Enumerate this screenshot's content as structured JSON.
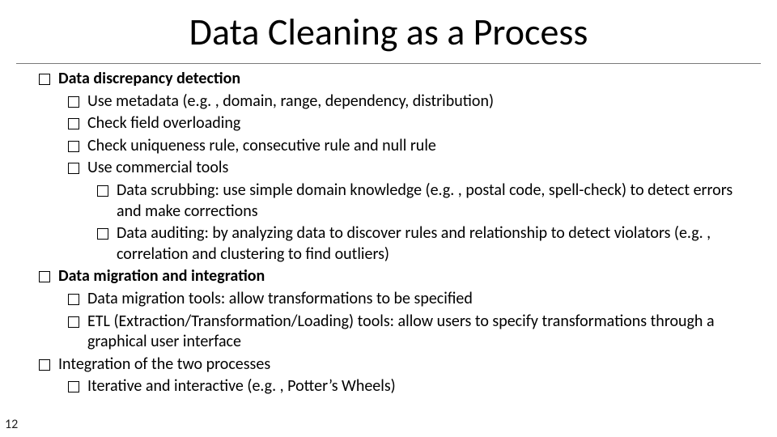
{
  "slide": {
    "title": "Data Cleaning as a Process",
    "page_number": "12",
    "items": {
      "i0": "Data discrepancy detection",
      "i1": "Use metadata (e.g. , domain, range, dependency, distribution)",
      "i2": "Check field overloading",
      "i3": "Check uniqueness rule, consecutive rule and null rule",
      "i4": "Use commercial tools",
      "i5": "Data scrubbing: use simple domain knowledge (e.g. , postal code, spell-check) to detect errors and make corrections",
      "i6": "Data auditing: by analyzing data to discover rules and relationship to detect violators (e.g. , correlation and clustering to find outliers)",
      "i7": "Data migration and integration",
      "i8": "Data migration tools: allow transformations to be specified",
      "i9": "ETL (Extraction/Transformation/Loading) tools: allow users to specify transformations through a graphical user interface",
      "i10": "Integration of the two processes",
      "i11": "Iterative and interactive (e.g. , Potter’s Wheels)"
    }
  }
}
